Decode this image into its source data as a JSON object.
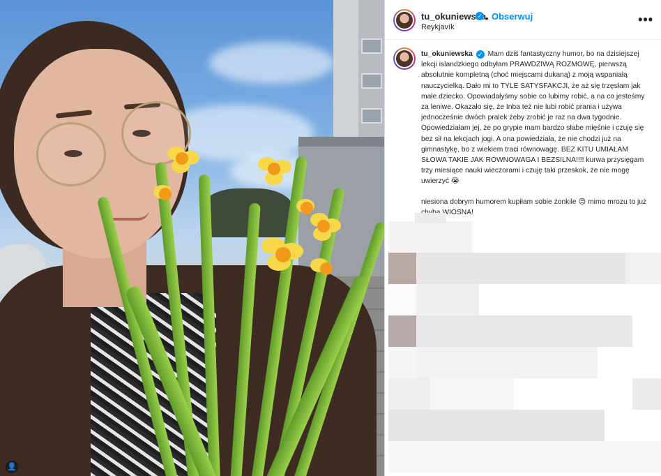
{
  "post": {
    "username": "tu_okuniewska",
    "verified_mark": "✓",
    "separator": "•",
    "follow_label": "Obserwuj",
    "location": "Reykjavík",
    "more_label": "•••",
    "caption_paragraph_1": "Mam dziś fantastyczny humor, bo na dzisiejszej lekcji islandzkiego odbyłam PRAWDZIWĄ ROZMOWĘ, pierwszą absolutnie kompletną (choć miejscami dukaną) z moją wspaniałą nauczycielką. Dało mi to TYLE SATYSFAKCJI, że aż się trzęsłam jak małe dziecko. Opowiadałyśmy sobie co lubimy robić, a na co jesteśmy za leniwe. Okazało się, że Inba też nie lubi robić prania i używa jednocześnie dwóch pralek żeby zrobić je raz na dwa tygodnie. Opowiedziałam jej, że po grypie mam bardzo słabe mięśnie i czuję się bez sił na lekcjach jogi. A ona powiedziała, że nie chodzi już na gimnastykę, bo z wiekiem traci równowagę. BEZ KITU UMIAŁAM SŁOWA TAKIE JAK RÓWNOWAGA I BEZSILNA!!!! kurwa przysięgam trzy miesiące nauki wieczorami i czuję taki przeskok, że nie mogę uwierzyć 😭",
    "caption_paragraph_2": "niesiona dobrym humorem kupiłam sobie żonkile 😍 mimo mrozu to już chyba WIOSNA!"
  },
  "photo": {
    "tagged_user_icon": "person-icon",
    "tagged_glyph": "👤"
  },
  "colors": {
    "follow": "#0095f6",
    "verified": "#0095f6",
    "text": "#262626"
  }
}
